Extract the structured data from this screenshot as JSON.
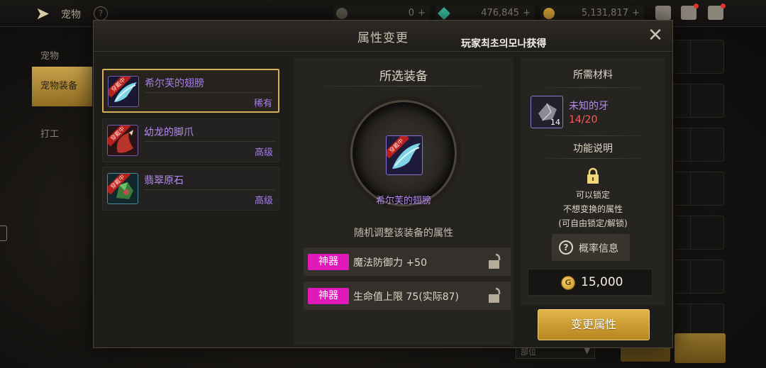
{
  "topbar": {
    "title": "宠物",
    "help_icon": "question-circle-icon",
    "currencies": [
      {
        "icon": "crystal-icon",
        "value": "0",
        "color": "#8a8a6e"
      },
      {
        "icon": "green-gem-icon",
        "value": "476,845",
        "color": "#36c0a0"
      },
      {
        "icon": "gold-coin-icon",
        "value": "5,131,817",
        "color": "#d9a233"
      }
    ]
  },
  "sidebar": {
    "items": [
      {
        "label": "宠物"
      },
      {
        "label": "宠物装备"
      },
      {
        "label": "打工"
      }
    ]
  },
  "modal": {
    "title": "属性变更",
    "subtitle": "玩家최초의모나获得",
    "close_icon": "close-icon"
  },
  "equipment_list": [
    {
      "name": "希尔芙的翅膀",
      "grade": "稀有",
      "tag": "穿戴中",
      "selected": true
    },
    {
      "name": "幼龙的脚爪",
      "grade": "高级",
      "tag": "穿戴中",
      "selected": false
    },
    {
      "name": "翡翠原石",
      "grade": "高级",
      "tag": "穿戴中",
      "selected": false
    }
  ],
  "selected_equipment": {
    "heading": "所选装备",
    "name": "希尔芙的翅膀",
    "tag": "穿戴中",
    "description": "随机调整该装备的属性",
    "attributes": [
      {
        "badge": "神器",
        "text": "魔法防御力 +50",
        "badge_color": "#e01ab8"
      },
      {
        "badge": "神器",
        "text": "生命值上限 75(实际87)",
        "badge_color": "#e01ab8"
      }
    ]
  },
  "materials": {
    "heading": "所需材料",
    "item_name": "未知的牙",
    "item_count": "14",
    "quantity": "14/20",
    "quantity_color": "#ff5a58"
  },
  "function": {
    "heading": "功能说明",
    "lines": [
      "可以锁定",
      "不想变换的属性",
      "(可自由锁定/解锁)"
    ],
    "probability_label": "概率信息"
  },
  "cost": {
    "value": "15,000"
  },
  "actions": {
    "change_label": "变更属性"
  },
  "background": {
    "select_label": "部位"
  }
}
